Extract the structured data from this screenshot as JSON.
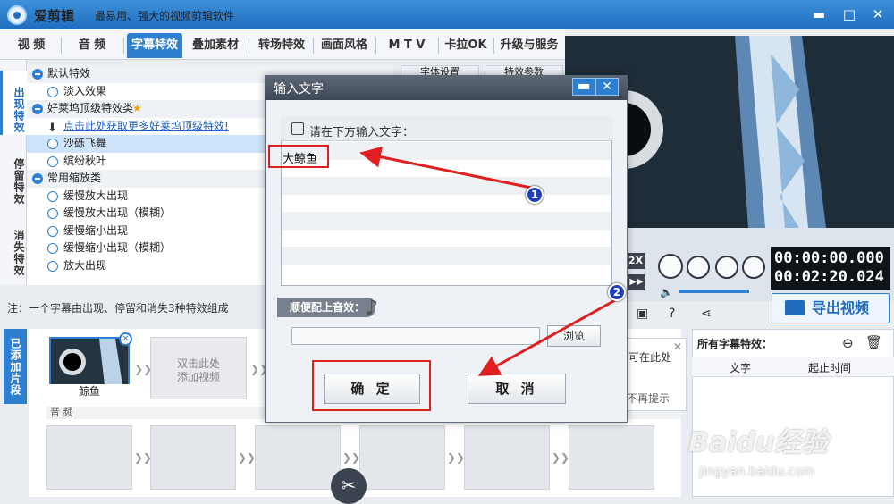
{
  "app": {
    "name": "爱剪辑",
    "slogan": "最易用、强大的视频剪辑软件"
  },
  "menu": [
    {
      "label": "视 频"
    },
    {
      "label": "音 频"
    },
    {
      "label": "字幕特效",
      "active": true
    },
    {
      "label": "叠加素材"
    },
    {
      "label": "转场特效"
    },
    {
      "label": "画面风格"
    },
    {
      "label": "M T V"
    },
    {
      "label": "卡拉OK"
    },
    {
      "label": "升级与服务"
    }
  ],
  "side_tabs": [
    {
      "label": "出现特效",
      "active": true
    },
    {
      "label": "停留特效"
    },
    {
      "label": "消失特效"
    }
  ],
  "effects": {
    "cat1": "默认特效",
    "item_fade": "淡入效果",
    "cat2": "好莱坞顶级特效类",
    "promo": "点击此处获取更多好莱坞顶级特效!",
    "item_sand": "沙砾飞舞",
    "item_leaves": "缤纷秋叶",
    "cat3": "常用缩放类",
    "zoom_items": [
      "缓慢放大出现",
      "缓慢放大出现（模糊）",
      "缓慢缩小出现",
      "缓慢缩小出现（模糊）",
      "放大出现"
    ]
  },
  "right_tabs": {
    "font": "字体设置",
    "params": "特效参数"
  },
  "tip": "注：一个字幕由出现、停留和消失3种特效组成",
  "player": {
    "speed": "2X",
    "time_current": "00:00:00.000",
    "time_total": "00:02:20.024"
  },
  "export": {
    "label": "导出视频"
  },
  "timeline": {
    "added_tab": "已添加片段",
    "clip_name": "鲸鱼",
    "add_video": "双击此处\n添加视频",
    "audio_label": "音 频"
  },
  "tip_popup": {
    "line1": "可在此处",
    "line2": "不再提示"
  },
  "fx_panel": {
    "title": "所有字幕特效：",
    "col_text": "文字",
    "col_time": "起止时间"
  },
  "dialog": {
    "title": "输入文字",
    "prompt": "请在下方输入文字：",
    "input_value": "大鲸鱼",
    "sound_label": "顺便配上音效：",
    "browse": "浏览",
    "ok": "确 定",
    "cancel": "取 消"
  },
  "annotations": {
    "badge1": "1",
    "badge2": "2",
    "arrow_color": "#e02020"
  },
  "watermark": {
    "brand": "Baidu经验",
    "url": "jingyan.baidu.com"
  },
  "colors": {
    "accent": "#2f7fd1",
    "titlebar": "#1f6cc0",
    "highlight": "#e02020"
  }
}
